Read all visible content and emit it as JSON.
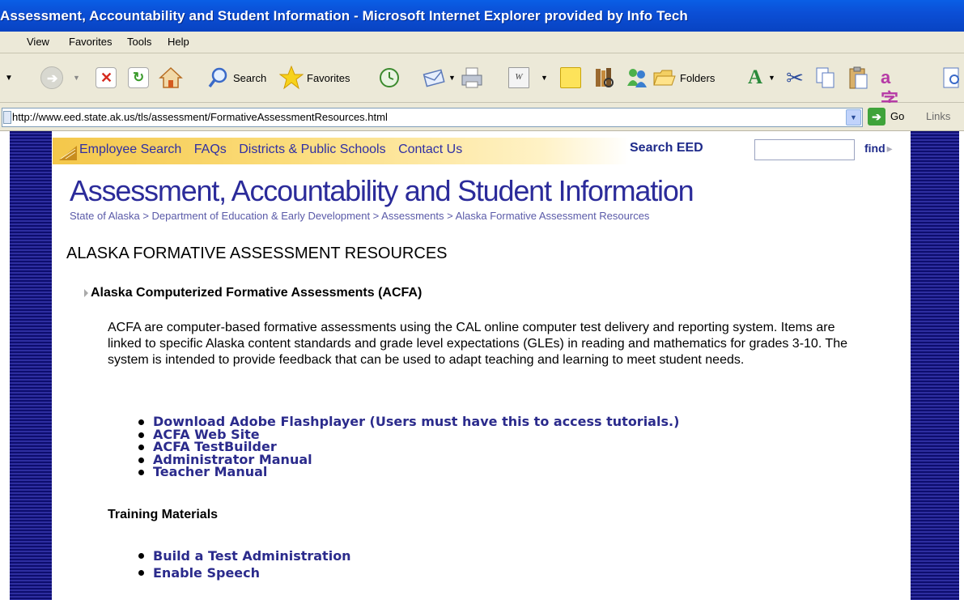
{
  "window": {
    "title": "Assessment, Accountability and Student Information - Microsoft Internet Explorer provided by Info Tech"
  },
  "menu": [
    "View",
    "Favorites",
    "Tools",
    "Help"
  ],
  "toolbar": {
    "search_label": "Search",
    "favorites_label": "Favorites",
    "folders_label": "Folders"
  },
  "address": {
    "url": "http://www.eed.state.ak.us/tls/assessment/FormativeAssessmentResources.html",
    "go_label": "Go",
    "links_label": "Links"
  },
  "site_nav": {
    "links": [
      "Employee Search",
      "FAQs",
      "Districts & Public Schools",
      "Contact Us"
    ],
    "search_label": "Search EED",
    "find_label": "find"
  },
  "page": {
    "site_title": "Assessment, Accountability and Student Information",
    "breadcrumb": "State of Alaska > Department of Education & Early Development > Assessments  > Alaska Formative Assessment Resources",
    "heading": "ALASKA FORMATIVE ASSESSMENT RESOURCES",
    "section_title": "Alaska Computerized Formative Assessments (ACFA)",
    "description": "ACFA are computer-based formative assessments using the CAL online computer test delivery and reporting system. Items are linked to specific Alaska content standards and grade level expectations (GLEs) in reading and mathematics for grades 3-10. The system is intended to provide feedback that can be used to adapt teaching and learning to meet student needs.",
    "links": [
      "Download Adobe Flashplayer (Users must have this to access tutorials.)",
      "ACFA Web Site",
      "ACFA TestBuilder",
      "Administrator Manual",
      "Teacher Manual"
    ],
    "training_title": "Training Materials",
    "training_links": [
      "Build a Test Administration",
      "Enable Speech"
    ]
  },
  "colors": {
    "titlebar": "#0b4fd6",
    "chrome": "#ece9d8",
    "link": "#2b2b8c",
    "sidebar": "#1e1e8a"
  },
  "icons": [
    "back-icon",
    "forward-icon",
    "stop-icon",
    "refresh-icon",
    "home-icon",
    "search-icon",
    "favorites-star-icon",
    "history-icon",
    "mail-icon",
    "print-icon",
    "edit-word-icon",
    "notes-icon",
    "research-icon",
    "messenger-icon",
    "folders-icon",
    "font-size-icon",
    "cut-icon",
    "copy-icon",
    "paste-icon",
    "translate-icon",
    "page-icon"
  ]
}
